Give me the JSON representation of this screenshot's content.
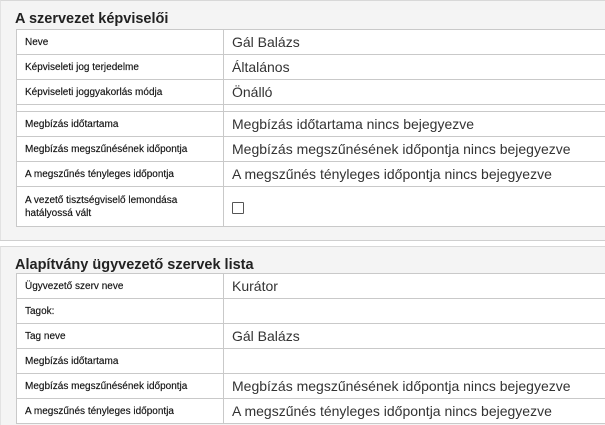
{
  "section1": {
    "title": "A szervezet képviselői",
    "rows": [
      {
        "label": "Neve",
        "value": "Gál Balázs"
      },
      {
        "label": "Képviseleti jog terjedelme",
        "value": "Általános"
      },
      {
        "label": "Képviseleti joggyakorlás módja",
        "value": "Önálló"
      },
      {
        "label": "Megbízás időtartama",
        "value": "Megbízás időtartama nincs bejegyezve"
      },
      {
        "label": "Megbízás megszűnésének időpontja",
        "value": "Megbízás megszűnésének időpontja nincs bejegyezve"
      },
      {
        "label": "A megszűnés tényleges időpontja",
        "value": "A megszűnés tényleges időpontja nincs bejegyezve"
      },
      {
        "label": "A vezető tisztségviselő lemondása hatályossá vált",
        "checked": false
      }
    ]
  },
  "section2": {
    "title": "Alapítvány ügyvezető szervek lista",
    "rows": [
      {
        "label": "Ügyvezető szerv neve",
        "value": "Kurátor"
      },
      {
        "label": "Tagok:",
        "value": ""
      },
      {
        "label": "Tag neve",
        "value": "Gál Balázs"
      },
      {
        "label": "Megbízás időtartama",
        "value": ""
      },
      {
        "label": "Megbízás megszűnésének időpontja",
        "value": "Megbízás megszűnésének időpontja nincs bejegyezve"
      },
      {
        "label": "A megszűnés tényleges időpontja",
        "value": "A megszűnés tényleges időpontja nincs bejegyezve"
      }
    ]
  }
}
